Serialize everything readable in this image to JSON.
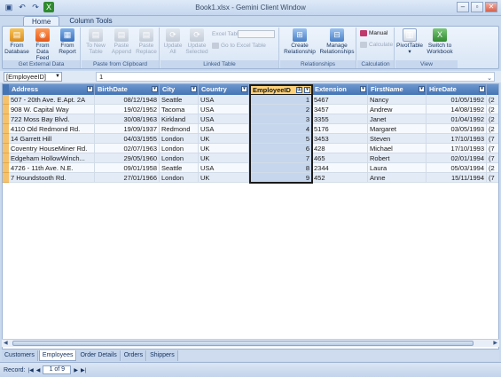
{
  "window": {
    "title": "Book1.xlsx - Gemini Client Window",
    "min_label": "–",
    "max_label": "▫",
    "close_label": "✕"
  },
  "qat": {
    "save_icon": "save-icon",
    "undo_icon": "undo-icon",
    "redo_icon": "redo-icon",
    "excel_icon": "excel-icon"
  },
  "tabs": [
    {
      "label": "Home"
    },
    {
      "label": "Column Tools"
    }
  ],
  "ribbon": {
    "external": {
      "label": "Get External Data",
      "buttons": [
        "From\nDatabase",
        "From\nData Feed",
        "From\nReport"
      ]
    },
    "clipboard": {
      "label": "Paste from Clipboard",
      "buttons": [
        "To New\nTable",
        "Paste\nAppend",
        "Paste\nReplace"
      ]
    },
    "linked": {
      "label": "Linked Table",
      "buttons": [
        "Update\nAll",
        "Update\nSelected"
      ],
      "excel_table_label": "Excel Table:",
      "go_label": "Go to Excel Table"
    },
    "relationships": {
      "label": "Relationships",
      "buttons": [
        "Create\nRelationship",
        "Manage\nRelationships"
      ]
    },
    "calculation": {
      "label": "Calculation",
      "manual": "Manual",
      "calculate": "Calculate"
    },
    "view": {
      "label": "View",
      "buttons": [
        "PivotTable",
        "Switch to\nWorkbook"
      ]
    }
  },
  "formula": {
    "name": "[EmployeeID]",
    "value": "1"
  },
  "grid": {
    "columns": [
      "Address",
      "BirthDate",
      "City",
      "Country",
      "EmployeeID",
      "Extension",
      "FirstName",
      "HireDate"
    ],
    "rows": [
      [
        "507 - 20th Ave. E.Apt. 2A",
        "08/12/1948",
        "Seattle",
        "USA",
        "1",
        "5467",
        "Nancy",
        "01/05/1992",
        "(2"
      ],
      [
        "908 W. Capital Way",
        "19/02/1952",
        "Tacoma",
        "USA",
        "2",
        "3457",
        "Andrew",
        "14/08/1992",
        "(2"
      ],
      [
        "722 Moss Bay Blvd.",
        "30/08/1963",
        "Kirkland",
        "USA",
        "3",
        "3355",
        "Janet",
        "01/04/1992",
        "(2"
      ],
      [
        "4110 Old Redmond Rd.",
        "19/09/1937",
        "Redmond",
        "USA",
        "4",
        "5176",
        "Margaret",
        "03/05/1993",
        "(2"
      ],
      [
        "14 Garrett Hill",
        "04/03/1955",
        "London",
        "UK",
        "5",
        "3453",
        "Steven",
        "17/10/1993",
        "(7"
      ],
      [
        "Coventry HouseMiner Rd.",
        "02/07/1963",
        "London",
        "UK",
        "6",
        "428",
        "Michael",
        "17/10/1993",
        "(7"
      ],
      [
        "Edgeham HollowWinch...",
        "29/05/1960",
        "London",
        "UK",
        "7",
        "465",
        "Robert",
        "02/01/1994",
        "(7"
      ],
      [
        "4726 - 11th Ave. N.E.",
        "09/01/1958",
        "Seattle",
        "USA",
        "8",
        "2344",
        "Laura",
        "05/03/1994",
        "(2"
      ],
      [
        "7 Houndstooth Rd.",
        "27/01/1966",
        "London",
        "UK",
        "9",
        "452",
        "Anne",
        "15/11/1994",
        "(7"
      ]
    ]
  },
  "sheets": [
    "Customers",
    "Employees",
    "Order Details",
    "Orders",
    "Shippers"
  ],
  "status": {
    "record_label": "Record:",
    "position": "1 of 9"
  }
}
